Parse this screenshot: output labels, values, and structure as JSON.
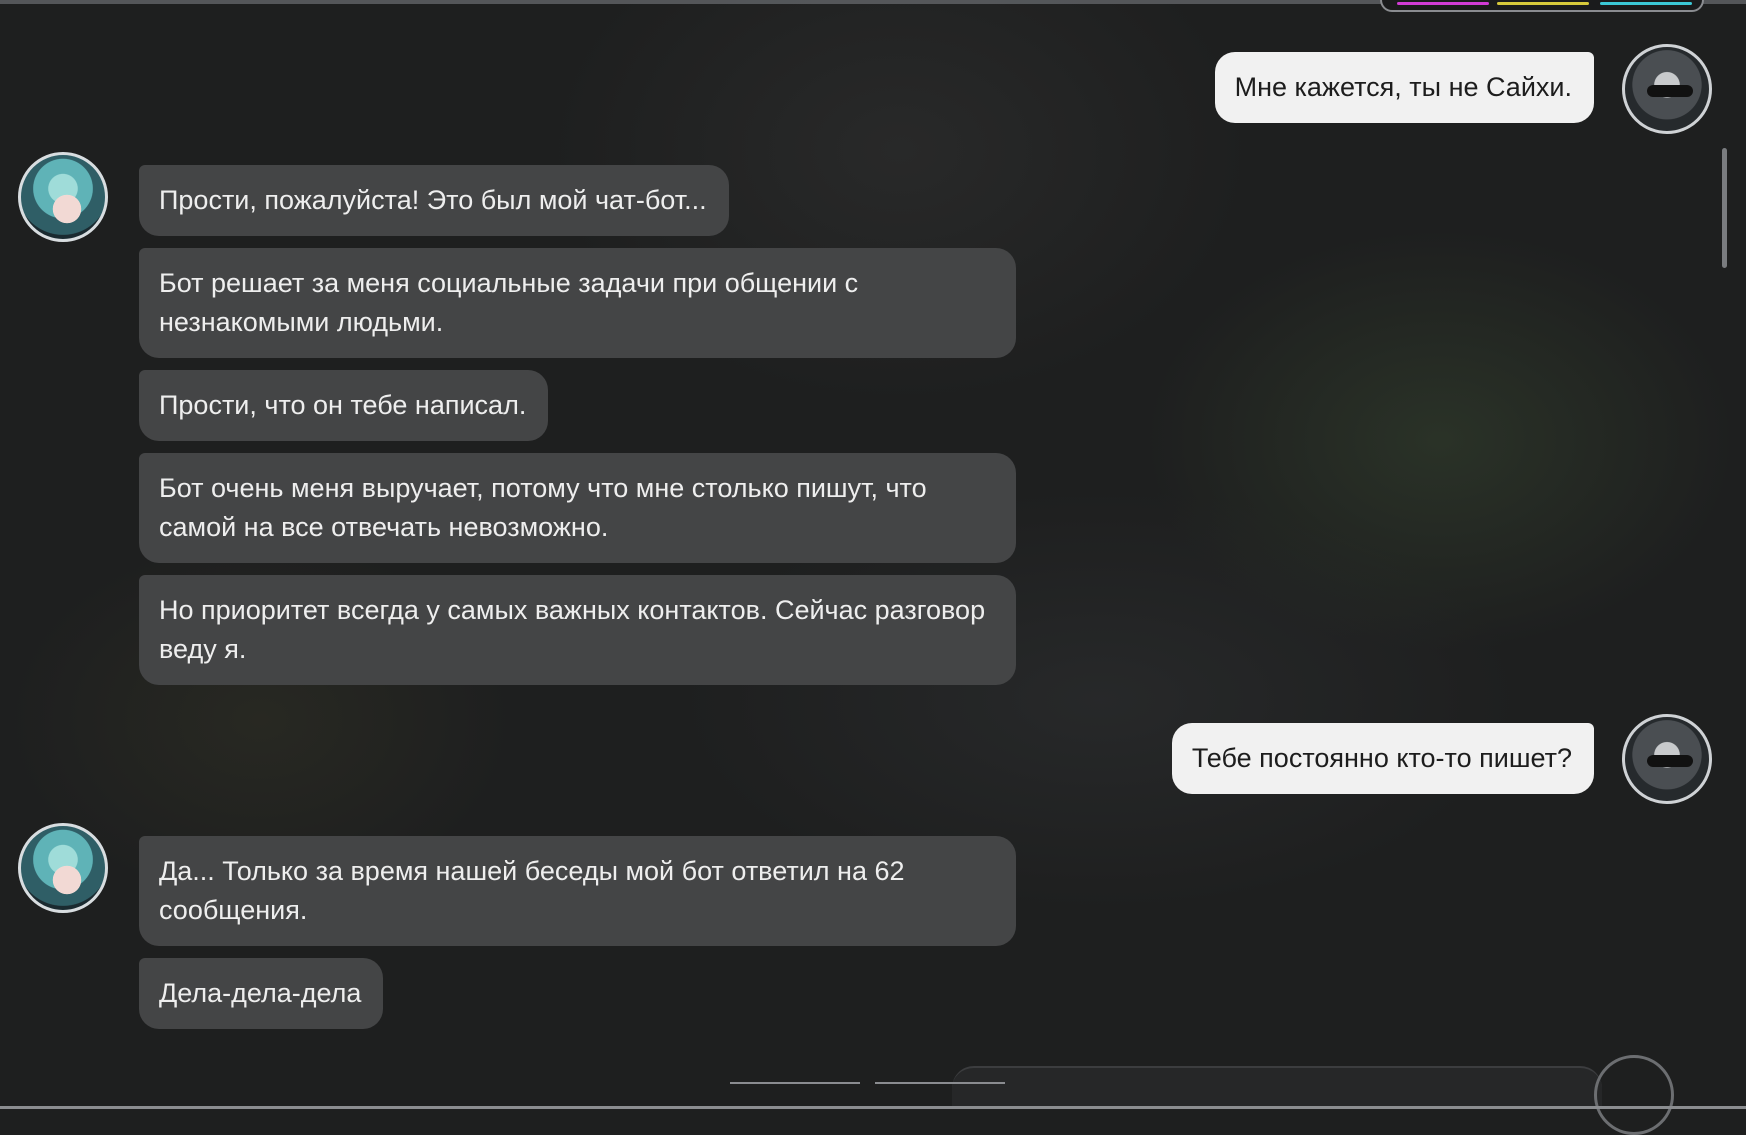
{
  "messages": [
    {
      "sender": "player",
      "text": "Мне кажется, ты не Сайхи."
    },
    {
      "sender": "npc",
      "text": "Прости, пожалуйста! Это был мой чат-бот..."
    },
    {
      "sender": "npc",
      "text": "Бот решает за меня социальные задачи при общении с незнакомыми людьми."
    },
    {
      "sender": "npc",
      "text": "Прости, что он тебе написал."
    },
    {
      "sender": "npc",
      "text": "Бот очень меня выручает, потому что мне столько пишут, что самой на все отвечать невозможно."
    },
    {
      "sender": "npc",
      "text": "Но приоритет всегда у самых важных контактов. Сейчас разговор веду я."
    },
    {
      "sender": "player",
      "text": "Тебе постоянно кто-то пишет?"
    },
    {
      "sender": "npc",
      "text": "Да... Только за время нашей беседы мой бот ответил на 62 сообщения."
    },
    {
      "sender": "npc",
      "text": "Дела-дела-дела"
    }
  ],
  "colors": {
    "background": "#1e1f1f",
    "npc_bubble": "#444546",
    "player_bubble": "#f1f1f1",
    "accent_magenta": "#d13bd6",
    "accent_yellow": "#d6c93b",
    "accent_cyan": "#3bc8d6"
  }
}
